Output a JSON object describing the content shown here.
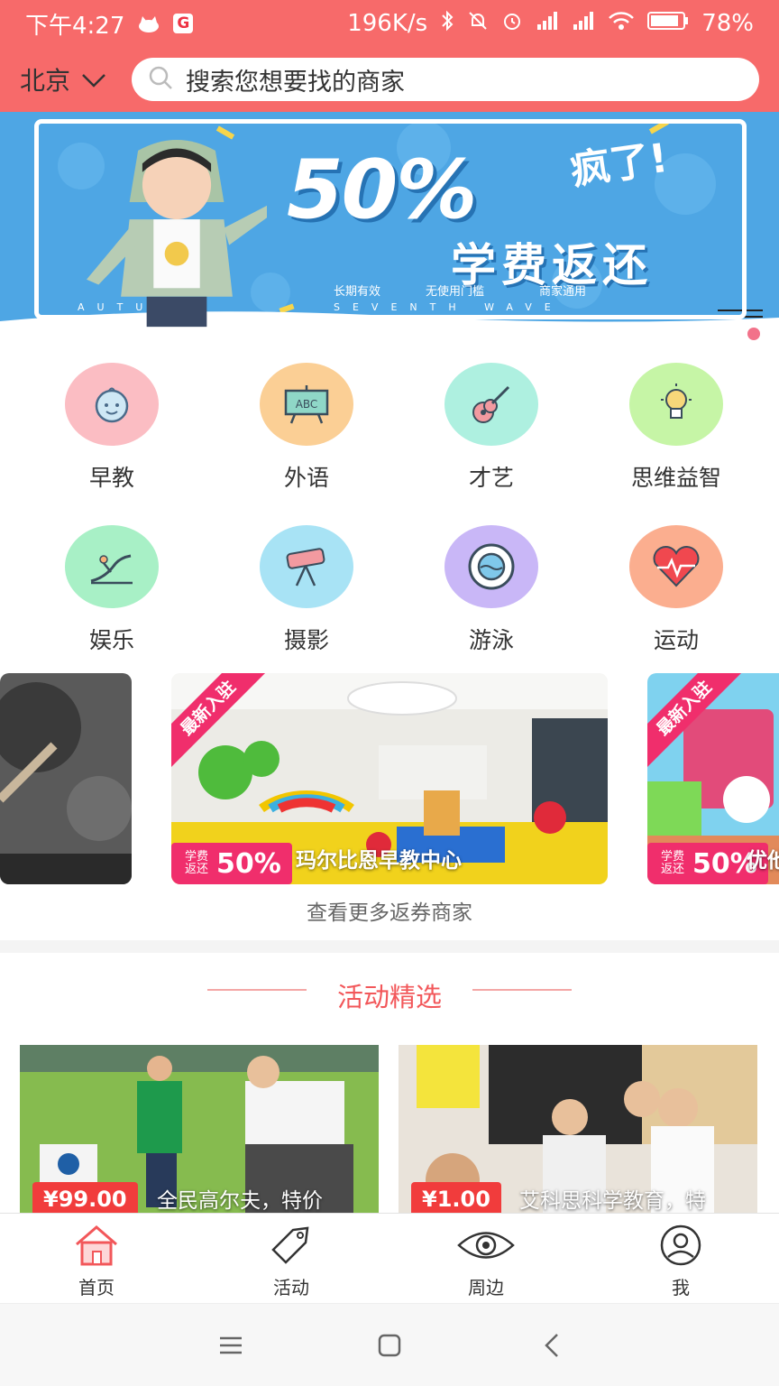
{
  "status_bar": {
    "time": "下午4:27",
    "speed": "196K/s",
    "battery": "78%"
  },
  "header": {
    "city": "北京",
    "search_placeholder": "搜索您想要找的商家"
  },
  "banner": {
    "percent": "50%",
    "headline": "学费返还",
    "exclaim": "疯了!",
    "tags": [
      "长期有效",
      "无使用门槛",
      "商家通用"
    ],
    "wave_text": "SEVENTH WAVE",
    "autu_text": "AUTU"
  },
  "categories": [
    {
      "label": "早教",
      "icon": "baby-face-icon",
      "color": "#fbbdc3"
    },
    {
      "label": "外语",
      "icon": "abc-board-icon",
      "color": "#fbcf95"
    },
    {
      "label": "才艺",
      "icon": "guitar-icon",
      "color": "#aef0e0"
    },
    {
      "label": "思维益智",
      "icon": "lightbulb-icon",
      "color": "#c6f5a6"
    },
    {
      "label": "娱乐",
      "icon": "slide-icon",
      "color": "#a8f0c6"
    },
    {
      "label": "摄影",
      "icon": "telescope-icon",
      "color": "#a8e3f5"
    },
    {
      "label": "游泳",
      "icon": "swim-ring-icon",
      "color": "#c9b7f7"
    },
    {
      "label": "运动",
      "icon": "heartbeat-icon",
      "color": "#fbae8f"
    }
  ],
  "merchants": {
    "items": [
      {
        "name": "玛尔比恩早教中心",
        "ribbon": "最新入驻",
        "badge_small": "学费返还",
        "badge_pct": "50%"
      },
      {
        "name": "优他",
        "ribbon": "最新入驻",
        "badge_small": "学费返还",
        "badge_pct": "50%"
      }
    ],
    "more_link": "查看更多返券商家"
  },
  "activities": {
    "title": "活动精选",
    "items": [
      {
        "price": "¥99.00",
        "title": "全民高尔夫，特价"
      },
      {
        "price": "¥1.00",
        "title": "艾科思科学教育，特"
      }
    ]
  },
  "tabs": [
    {
      "label": "首页",
      "icon": "home-icon",
      "active": true
    },
    {
      "label": "活动",
      "icon": "tag-icon",
      "active": false
    },
    {
      "label": "周边",
      "icon": "eye-icon",
      "active": false
    },
    {
      "label": "我",
      "icon": "user-icon",
      "active": false
    }
  ],
  "colors": {
    "brand": "#f76a6a",
    "accent_pink": "#f02e6c",
    "price_red": "#f13c3c"
  }
}
